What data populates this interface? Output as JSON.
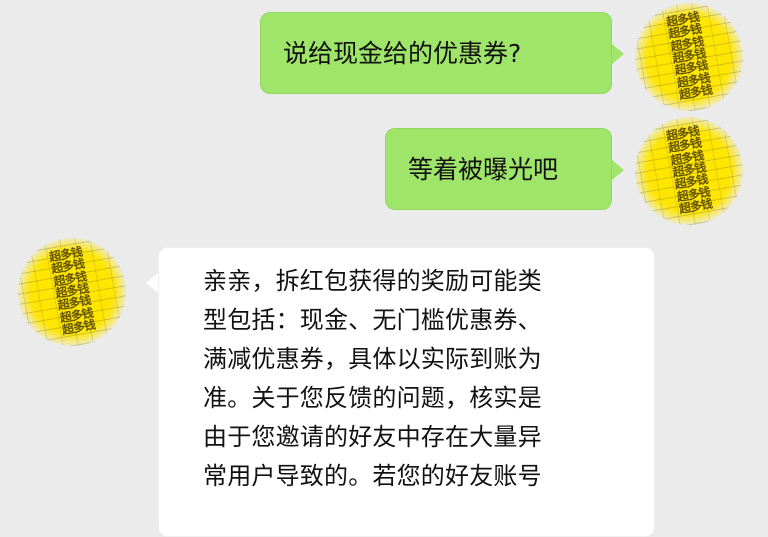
{
  "messages": [
    {
      "side": "right",
      "text": "说给现金给的优惠券?"
    },
    {
      "side": "right",
      "text": "等着被曝光吧"
    },
    {
      "side": "left",
      "lines": [
        "亲亲，拆红包获得的奖励可能类",
        "型包括：现金、无门槛优惠券、",
        "满减优惠券，具体以实际到账为",
        "准。关于您反馈的问题，核实是",
        "由于您邀请的好友中存在大量异",
        "常用户导致的。若您的好友账号"
      ]
    }
  ],
  "avatar_pattern": {
    "text": "超多钱",
    "icon": "coin-pattern-avatar"
  },
  "colors": {
    "background": "#ebebeb",
    "outgoing_bubble": "#9fe56a",
    "incoming_bubble": "#ffffff",
    "text": "#111111",
    "avatar": "#ffe600"
  }
}
